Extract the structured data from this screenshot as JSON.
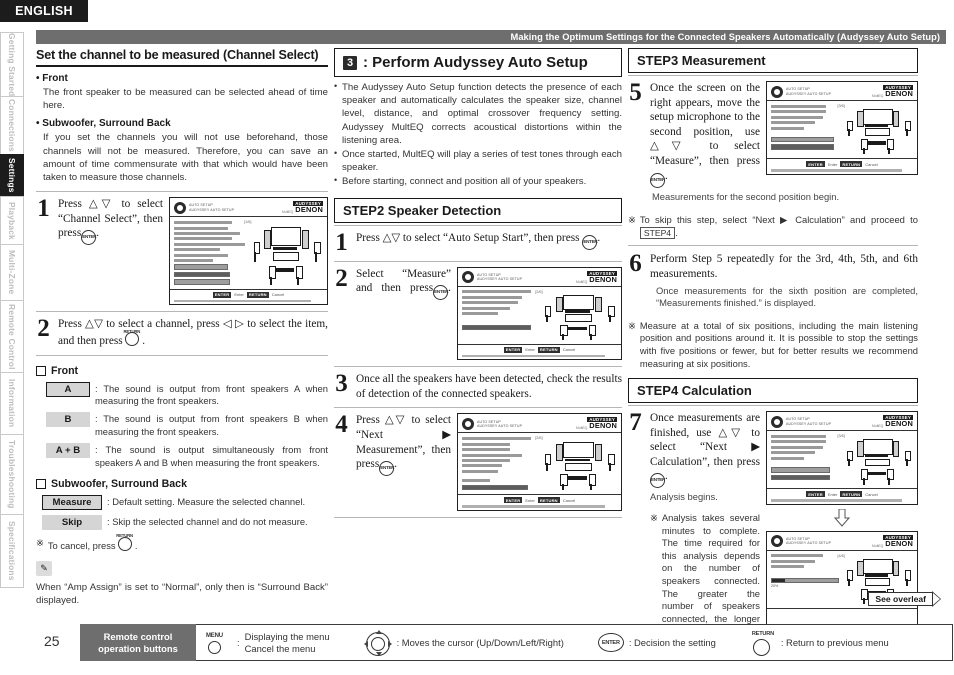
{
  "language_tab": "ENGLISH",
  "running_head": "Making the Optimum Settings for the Connected Speakers Automatically (Audyssey Auto Setup)",
  "sidebar": {
    "items": [
      {
        "label": "Getting Started",
        "active": false
      },
      {
        "label": "Connections",
        "active": false
      },
      {
        "label": "Settings",
        "active": true
      },
      {
        "label": "Playback",
        "active": false
      },
      {
        "label": "Multi-Zone",
        "active": false
      },
      {
        "label": "Remote Control",
        "active": false
      },
      {
        "label": "Information",
        "active": false
      },
      {
        "label": "Troubleshooting",
        "active": false
      },
      {
        "label": "Specifications",
        "active": false
      }
    ]
  },
  "col1": {
    "title": "Set the channel to be measured (Channel Select)",
    "front_label": "• Front",
    "front_text": "The front speaker to be measured can be selected ahead of time here.",
    "sub_label": "• Subwoofer, Surround Back",
    "sub_text": "If you set the channels you will not use beforehand, those channels will not be measured. Therefore, you can save an amount of time commensurate with that which would have been taken to measure those channels.",
    "steps": [
      {
        "n": "1",
        "text": "Press △▽ to select “Channel Select”, then press",
        "has_enter": true,
        "has_osd": true
      },
      {
        "n": "2",
        "text": "Press △▽ to select a channel, press ◁ ▷ to select the item, and then press",
        "has_return": true,
        "has_osd": false
      }
    ],
    "front_group_title": "Front",
    "front_defs": [
      {
        "key": "A",
        "desc": "The sound is output from front speakers A when measuring the front speakers."
      },
      {
        "key": "B",
        "desc": "The sound is output from front speakers B when measuring the front speakers."
      },
      {
        "key": "A + B",
        "desc": "The sound is output simultaneously from front speakers A and B when measuring the front speakers."
      }
    ],
    "sub_group_title": "Subwoofer, Surround Back",
    "sub_defs": [
      {
        "key": "Measure",
        "desc": "Default setting. Measure the selected channel."
      },
      {
        "key": "Skip",
        "desc": "Skip the selected channel and do not measure."
      }
    ],
    "cancel_note": "To cancel, press",
    "tip_text": "When “Amp Assign” is set to “Normal”, only then is “Surround Back” displayed."
  },
  "col2": {
    "header_num": "3",
    "header_title": ": Perform Audyssey Auto Setup",
    "bullets": [
      "The Audyssey Auto Setup function detects the presence of each speaker and automatically calculates the speaker size, channel level, distance, and optimal crossover frequency setting. Audyssey MultEQ corrects acoustical distortions within the listening area.",
      "Once started, MultEQ will play a series of test tones through each speaker.",
      "Before starting, connect and position all of your speakers."
    ],
    "step_box_title": "STEP2 Speaker Detection",
    "steps": [
      {
        "n": "1",
        "text": "Press △▽ to select “Auto Setup Start”, then press",
        "has_enter": true,
        "has_osd": false
      },
      {
        "n": "2",
        "text": "Select “Measure” and then press",
        "has_enter": true,
        "has_osd": true
      },
      {
        "n": "3",
        "text": "Once all the speakers have been detected, check the results of detection of the connected speakers.",
        "has_enter": false,
        "has_osd": false
      },
      {
        "n": "4",
        "text": "Press △▽ to select “Next ▶ Measurement”, then press",
        "has_enter": true,
        "has_osd": true
      }
    ]
  },
  "col3": {
    "step3_box_title": "STEP3 Measurement",
    "step5": {
      "n": "5",
      "text": "Once the screen on the right appears, move the setup microphone to the second position, use △▽ to select “Measure”, then press",
      "sub": "Measurements for the second position begin.",
      "note_mark": "※",
      "note_a": "To skip this step, select “Next ▶ Calculation” and proceed to",
      "note_box": "STEP4",
      "note_b": "."
    },
    "step6": {
      "n": "6",
      "text": "Perform Step 5 repeatedly for the 3rd, 4th, 5th, and 6th measurements.",
      "sub": "Once measurements for the sixth position are completed, “Measurements finished.” is displayed.",
      "note_mark": "※",
      "note": "Measure at a total of six positions, including the main listening position and positions around it. It is possible to stop the settings with five positions or fewer, but for better results we recommend measuring at six positions."
    },
    "step4_box_title": "STEP4 Calculation",
    "step7": {
      "n": "7",
      "text": "Once measurements are finished, use △▽ to select “Next ▶ Calculation”, then press",
      "sub": "Analysis begins.",
      "note_mark": "※",
      "note": "Analysis takes several minutes to complete. The time required for this analysis depends on the number of speakers connected. The greater the number of speakers connected, the longer analysis will take."
    }
  },
  "osd": {
    "title_line1": "AUTO SETUP",
    "title_line2": "AUDYSSEY AUTO SETUP",
    "logo": "AUDYSSEY",
    "brand": "DENON",
    "brand_sub": "MultEQ",
    "enter_label": "ENTER",
    "enter_caption": "Enter",
    "return_label": "RETURN",
    "return_caption": "Cancel",
    "screens": [
      {
        "id": "step1-preparation",
        "page": "[1/6]",
        "heading": "STEP1 Preparation"
      },
      {
        "id": "step2-speaker-detection",
        "page": "[2/6]",
        "heading": "STEP2 Speaker Detection"
      },
      {
        "id": "step2-detect-check",
        "page": "[2/6]",
        "heading": "STEP2 Spkr Detect Check"
      },
      {
        "id": "step3-measurement-2nd",
        "page": "[3/6]",
        "heading": "STEP3 Measurement"
      },
      {
        "id": "step3-measurement-last",
        "page": "[3/6]",
        "heading": "STEP3 Measurement"
      },
      {
        "id": "step4-calculation",
        "page": "[4/6]",
        "heading": "STEP4 Calculation",
        "progress": "20%"
      }
    ]
  },
  "overleaf": "See overleaf",
  "footer": {
    "page_number": "25",
    "title_line1": "Remote control",
    "title_line2": "operation buttons",
    "items": [
      {
        "glyph": "menu",
        "label": "MENU",
        "line1": "Displaying the menu",
        "line2": "Cancel the menu"
      },
      {
        "glyph": "cursor",
        "label": "",
        "text": ": Moves the cursor (Up/Down/Left/Right)"
      },
      {
        "glyph": "enter",
        "label": "ENTER",
        "text": ": Decision the setting"
      },
      {
        "glyph": "return",
        "label": "RETURN",
        "text": ": Return to previous menu"
      }
    ]
  },
  "colors": {
    "header_bar": "#6e6e6e",
    "active_tab": "#1c1c1c",
    "chip_bg": "#d5d5d5",
    "panel_bg": "#f0f0f0"
  }
}
